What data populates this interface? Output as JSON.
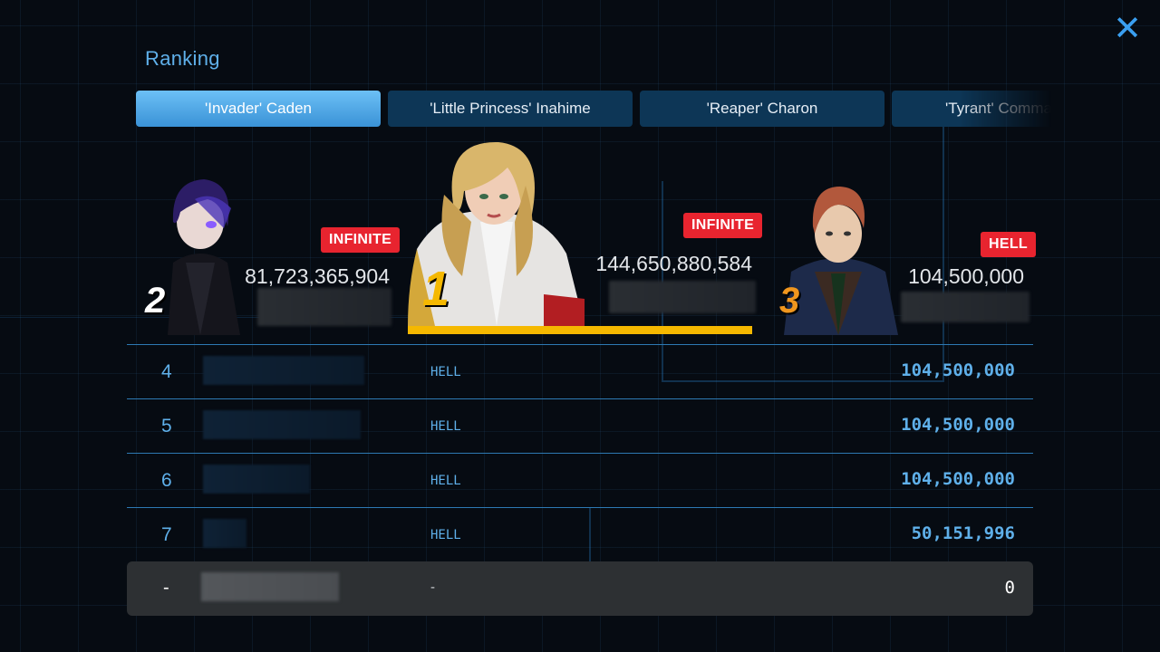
{
  "header": {
    "title": "Ranking",
    "close_label": "✕"
  },
  "tabs": [
    {
      "label": "'Invader' Caden",
      "active": true
    },
    {
      "label": "'Little Princess' Inahime",
      "active": false
    },
    {
      "label": "'Reaper' Charon",
      "active": false
    },
    {
      "label": "'Tyrant' Commander",
      "active": false
    }
  ],
  "podium": {
    "first": {
      "rank": "1",
      "mode": "INFINITE",
      "score": "144,650,880,584"
    },
    "second": {
      "rank": "2",
      "mode": "INFINITE",
      "score": "81,723,365,904"
    },
    "third": {
      "rank": "3",
      "mode": "HELL",
      "score": "104,500,000"
    }
  },
  "rows": [
    {
      "rank": "4",
      "mode": "HELL",
      "score": "104,500,000"
    },
    {
      "rank": "5",
      "mode": "HELL",
      "score": "104,500,000"
    },
    {
      "rank": "6",
      "mode": "HELL",
      "score": "104,500,000"
    },
    {
      "rank": "7",
      "mode": "HELL",
      "score": "50,151,996"
    }
  ],
  "self": {
    "rank": "-",
    "mode": "-",
    "score": "0"
  },
  "colors": {
    "accent": "#5fb0ea",
    "badge": "#e8242f",
    "gold": "#f5b800",
    "tab_inactive": "#0d3656"
  }
}
